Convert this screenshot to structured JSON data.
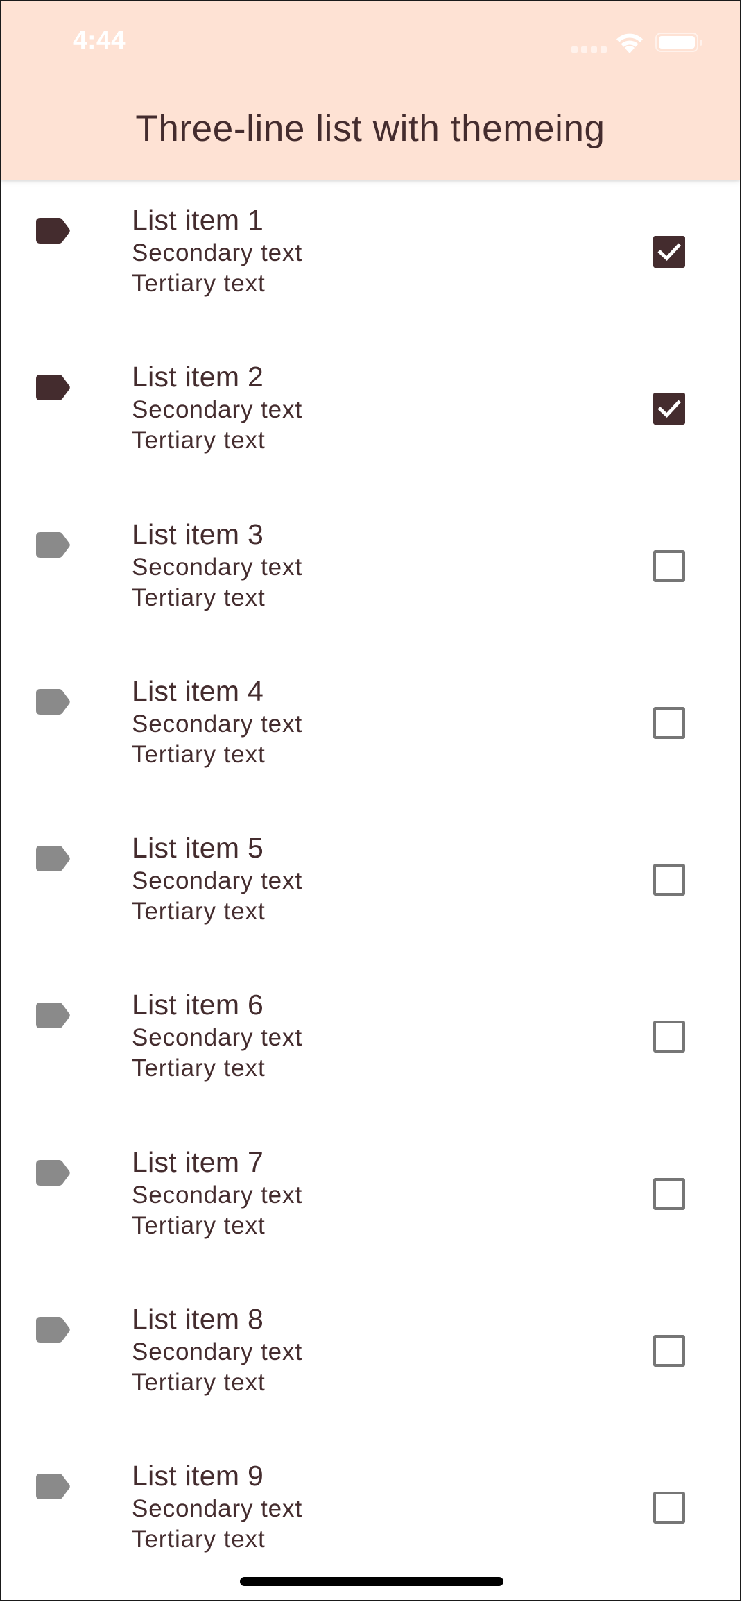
{
  "status_bar": {
    "time": "4:44",
    "signal_icon": "cellular-signal-icon",
    "wifi_icon": "wifi-icon",
    "battery_icon": "battery-icon"
  },
  "appbar": {
    "title": "Three-line list with themeing"
  },
  "theme": {
    "primary": "#FEE2D4",
    "on_primary": "#442C2E",
    "icon_inactive": "#8A8A8A",
    "checkbox_border": "#767676"
  },
  "list": {
    "items": [
      {
        "primary": "List item 1",
        "secondary": "Secondary text",
        "tertiary": "Tertiary text",
        "icon": "label-icon",
        "checked": true
      },
      {
        "primary": "List item 2",
        "secondary": "Secondary text",
        "tertiary": "Tertiary text",
        "icon": "label-icon",
        "checked": true
      },
      {
        "primary": "List item 3",
        "secondary": "Secondary text",
        "tertiary": "Tertiary text",
        "icon": "label-icon",
        "checked": false
      },
      {
        "primary": "List item 4",
        "secondary": "Secondary text",
        "tertiary": "Tertiary text",
        "icon": "label-icon",
        "checked": false
      },
      {
        "primary": "List item 5",
        "secondary": "Secondary text",
        "tertiary": "Tertiary text",
        "icon": "label-icon",
        "checked": false
      },
      {
        "primary": "List item 6",
        "secondary": "Secondary text",
        "tertiary": "Tertiary text",
        "icon": "label-icon",
        "checked": false
      },
      {
        "primary": "List item 7",
        "secondary": "Secondary text",
        "tertiary": "Tertiary text",
        "icon": "label-icon",
        "checked": false
      },
      {
        "primary": "List item 8",
        "secondary": "Secondary text",
        "tertiary": "Tertiary text",
        "icon": "label-icon",
        "checked": false
      },
      {
        "primary": "List item 9",
        "secondary": "Secondary text",
        "tertiary": "Tertiary text",
        "icon": "label-icon",
        "checked": false
      }
    ]
  }
}
